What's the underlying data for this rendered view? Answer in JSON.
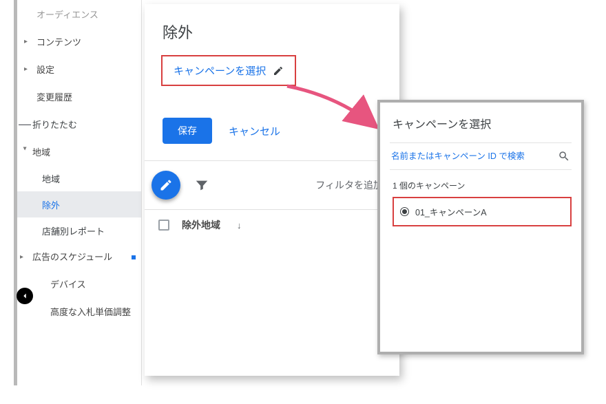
{
  "sidebar": {
    "top_partial": "オーディエンス",
    "items": [
      {
        "label": "コンテンツ",
        "expandable": true
      },
      {
        "label": "設定",
        "expandable": true
      },
      {
        "label": "変更履歴",
        "expandable": false
      }
    ],
    "collapse_label": "折りたたむ",
    "section": {
      "label": "地域",
      "children": [
        {
          "label": "地域",
          "active": false
        },
        {
          "label": "除外",
          "active": true
        },
        {
          "label": "店舗別レポート",
          "active": false
        }
      ],
      "extra": [
        {
          "label": "広告のスケジュール",
          "dot": true
        },
        {
          "label": "デバイス"
        },
        {
          "label": "高度な入札単価調整"
        }
      ]
    }
  },
  "main": {
    "title": "除外",
    "select_campaign": "キャンペーンを選択",
    "save_label": "保存",
    "cancel_label": "キャンセル",
    "add_filter_label": "フィルタを追加",
    "column_header": "除外地域"
  },
  "popup": {
    "title": "キャンペーンを選択",
    "search_placeholder": "名前またはキャンペーン ID で検索",
    "count_label": "1 個のキャンペーン",
    "item_label": "01_キャンペーンA"
  }
}
